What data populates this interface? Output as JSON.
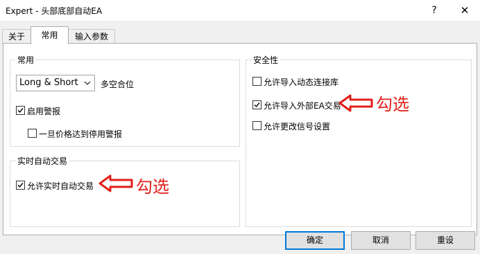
{
  "window": {
    "title": "Expert - 头部底部自动EA",
    "help_label": "?",
    "close_label": "✕"
  },
  "tabs": [
    {
      "label": "关于"
    },
    {
      "label": "常用"
    },
    {
      "label": "输入参数"
    }
  ],
  "common": {
    "group_title": "常用",
    "position_select_value": "Long & Short",
    "position_label": "多空合位",
    "enable_alerts": {
      "label": "启用警报",
      "checked": true
    },
    "disable_alerts_once": {
      "label": "一旦价格达到停用警报",
      "checked": false
    }
  },
  "live_trading": {
    "group_title": "实时自动交易",
    "allow_live": {
      "label": "允许实时自动交易",
      "checked": true
    }
  },
  "security": {
    "group_title": "安全性",
    "allow_dll": {
      "label": "允许导入动态连接库",
      "checked": false
    },
    "allow_external_ea": {
      "label": "允许导入外部EA交易",
      "checked": true
    },
    "allow_signal_change": {
      "label": "允许更改信号设置",
      "checked": false
    }
  },
  "annotations": {
    "mark_label": "勾选",
    "color": "#e0201b"
  },
  "buttons": {
    "ok_label": "确定",
    "cancel_label": "取消",
    "reset_label": "重设"
  }
}
